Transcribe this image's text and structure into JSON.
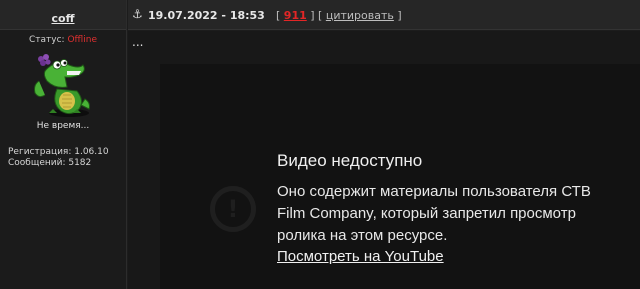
{
  "user": {
    "name": "coff",
    "status_label": "Статус: ",
    "status_value": "Offline",
    "title": "Не время...",
    "registration": "Регистрация: 1.06.10",
    "messages": "Сообщений: 5182"
  },
  "post": {
    "date": "19.07.2022 - 18:53",
    "bracket_open": "[ ",
    "number": "911",
    "bracket_mid": " ] [ ",
    "quote": "цитировать",
    "bracket_close": " ]",
    "body_text": "..."
  },
  "video": {
    "title": "Видео недоступно",
    "message": "Оно содержит материалы пользователя СТВ Film Company, который запретил просмотр ролика на этом ресурсе.",
    "link": "Посмотреть на YouTube"
  },
  "colors": {
    "offline": "#e03030",
    "post_number": "#e32626"
  },
  "icons": {
    "anchor": "anchor-icon",
    "warning": "exclamation-circle-icon",
    "avatar": "crocodile-avatar"
  }
}
